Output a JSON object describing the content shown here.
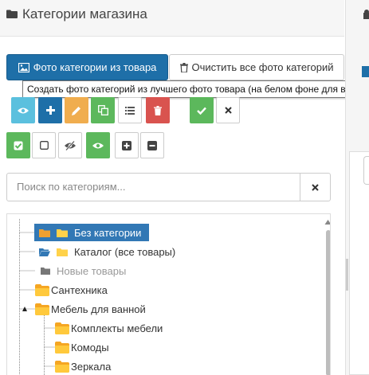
{
  "header": {
    "title": "Категории магазина",
    "icon": "folder-icon"
  },
  "buttons": {
    "photo_from_product": "Фото категории из товара",
    "clear_all_photos": "Очистить все фото категорий"
  },
  "tooltip": "Создать фото категорий из лучшего фото товара (на белом фоне для выбран",
  "toolbar_row1": [
    {
      "name": "view-button",
      "icon": "eye-icon",
      "color": "#5bc0de"
    },
    {
      "name": "add-button",
      "icon": "plus-icon",
      "color": "#1e6fa8"
    },
    {
      "name": "edit-button",
      "icon": "pencil-icon",
      "color": "#f0ad4e"
    },
    {
      "name": "copy-button",
      "icon": "copy-icon",
      "color": "#5cb85c"
    },
    {
      "name": "list-button",
      "icon": "list-icon",
      "color": "#ffffff"
    },
    {
      "name": "delete-button",
      "icon": "trash-icon",
      "color": "#d9534f"
    },
    {
      "name": "confirm-button",
      "icon": "check-icon",
      "color": "#5cb85c"
    },
    {
      "name": "cancel-button",
      "icon": "times-icon",
      "color": "#ffffff"
    }
  ],
  "toolbar_row2": [
    {
      "name": "select-all-button",
      "icon": "checked-box-icon",
      "color": "#5cb85c"
    },
    {
      "name": "deselect-all-button",
      "icon": "empty-box-icon",
      "color": "#ffffff"
    },
    {
      "name": "hide-button",
      "icon": "eye-slash-icon",
      "color": "#ffffff"
    },
    {
      "name": "show-button",
      "icon": "eye-icon",
      "color": "#5cb85c"
    },
    {
      "name": "expand-button",
      "icon": "plus-square-icon",
      "color": "#ffffff"
    },
    {
      "name": "collapse-button",
      "icon": "minus-square-icon",
      "color": "#ffffff"
    }
  ],
  "search": {
    "placeholder": "Поиск по категориям..."
  },
  "tree": [
    {
      "label": "Без категории",
      "selected": true,
      "muted": false
    },
    {
      "label": "Каталог (все товары)",
      "selected": false,
      "muted": false
    },
    {
      "label": "Новые товары",
      "selected": false,
      "muted": true
    },
    {
      "label": "Сантехника",
      "selected": false,
      "muted": false
    },
    {
      "label": "Мебель для ванной",
      "selected": false,
      "muted": false
    },
    {
      "label": "Комплекты мебели",
      "selected": false,
      "muted": false
    },
    {
      "label": "Комоды",
      "selected": false,
      "muted": false
    },
    {
      "label": "Зеркала",
      "selected": false,
      "muted": false
    }
  ]
}
